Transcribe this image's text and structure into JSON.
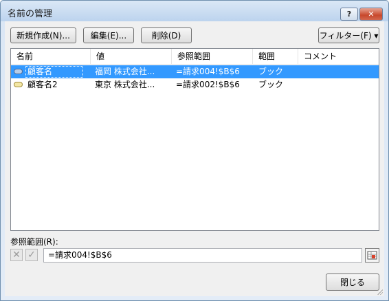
{
  "window": {
    "title": "名前の管理",
    "help_glyph": "?",
    "close_glyph": "✕"
  },
  "toolbar": {
    "new_label": "新規作成(N)...",
    "edit_label": "編集(E)...",
    "delete_label": "削除(D)",
    "filter_label": "フィルター(F) ▾"
  },
  "table": {
    "columns": [
      "名前",
      "値",
      "参照範囲",
      "範囲",
      "コメント"
    ],
    "rows": [
      {
        "name": "顧客名",
        "value": "福岡 株式会社...",
        "ref": "=請求004!$B$6",
        "scope": "ブック",
        "comment": "",
        "selected": true
      },
      {
        "name": "顧客名2",
        "value": "東京 株式会社...",
        "ref": "=請求002!$B$6",
        "scope": "ブック",
        "comment": "",
        "selected": false
      }
    ]
  },
  "reference": {
    "label": "参照範囲(R):",
    "value": "=請求004!$B$6"
  },
  "footer": {
    "close_label": "閉じる"
  },
  "colors": {
    "selection": "#3399ff",
    "titlebar": "#bcd3ee"
  }
}
